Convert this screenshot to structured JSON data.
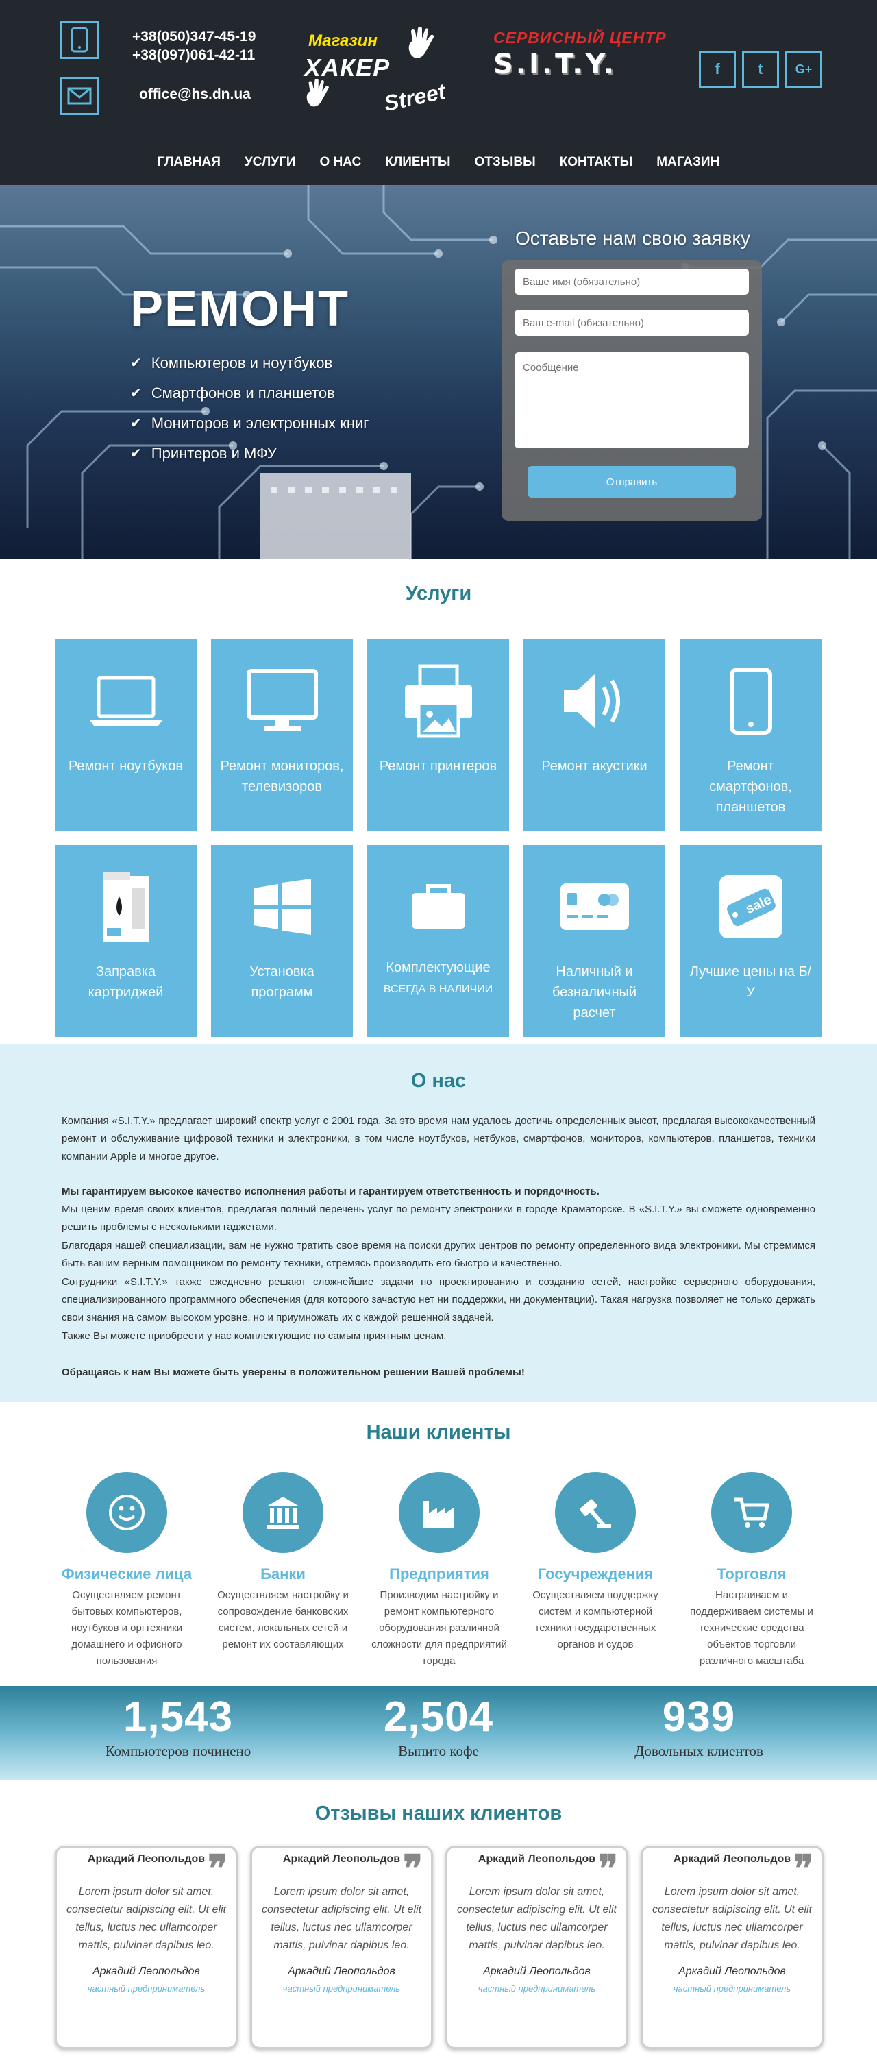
{
  "header": {
    "phones": [
      "+38(050)347-45-19",
      "+38(097)061-42-11"
    ],
    "email": "office@hs.dn.ua",
    "shop_logo": {
      "line1": "Магазин",
      "line2": "ХАКЕР",
      "line3": "Street"
    },
    "service_logo": {
      "line1": "СЕРВИСНЫЙ ЦЕНТР",
      "line2": "S.I.T.Y."
    },
    "social": [
      {
        "icon": "facebook-icon",
        "glyph": "f"
      },
      {
        "icon": "twitter-icon",
        "glyph": "t"
      },
      {
        "icon": "google-plus-icon",
        "glyph": "G+"
      }
    ],
    "nav": [
      "ГЛАВНАЯ",
      "УСЛУГИ",
      "О НАС",
      "КЛИЕНТЫ",
      "ОТЗЫВЫ",
      "КОНТАКТЫ",
      "МАГАЗИН"
    ]
  },
  "hero": {
    "title": "РЕМОНТ",
    "items": [
      "Компьютеров и ноутбуков",
      "Смартфонов и планшетов",
      "Мониторов и электронных книг",
      "Принтеров и МФУ"
    ],
    "form": {
      "title": "Оставьте нам свою заявку",
      "name_placeholder": "Ваше имя (обязательно)",
      "email_placeholder": "Ваш e-mail (обязательно)",
      "message_placeholder": "Сообщение",
      "submit": "Отправить"
    }
  },
  "services": {
    "title": "Услуги",
    "tiles": [
      {
        "label": "Ремонт ноутбуков",
        "icon": "laptop-icon"
      },
      {
        "label": "Ремонт мониторов, телевизоров",
        "icon": "monitor-icon"
      },
      {
        "label": "Ремонт принтеров",
        "icon": "printer-icon"
      },
      {
        "label": "Ремонт акустики",
        "icon": "speaker-icon"
      },
      {
        "label": "Ремонт смартфонов, планшетов",
        "icon": "smartphone-icon"
      },
      {
        "label": "Заправка картриджей",
        "icon": "cartridge-icon"
      },
      {
        "label": "Установка программ",
        "icon": "windows-icon"
      },
      {
        "label": "Комплектующие",
        "sub": "всегда в наличии",
        "icon": "toolbox-icon"
      },
      {
        "label": "Наличный и безналичный расчет",
        "icon": "credit-card-icon"
      },
      {
        "label": "Лучшие цены на Б/У",
        "icon": "sale-tag-icon"
      }
    ]
  },
  "about": {
    "title": "О нас",
    "p1": "Компания «S.I.T.Y.» предлагает широкий спектр услуг с 2001 года. За это время нам удалось достичь определенных высот, предлагая высококачественный ремонт и обслуживание цифровой техники и электроники, в том числе ноутбуков, нетбуков, смартфонов, мониторов, компьютеров, планшетов, техники компании Apple и многое другое.",
    "p2_bold": "Мы гарантируем высокое качество исполнения работы и гарантируем ответственность и порядочность.",
    "p2": "Мы ценим время своих клиентов, предлагая полный перечень услуг по ремонту электроники в городе Краматорске. В «S.I.T.Y.» вы сможете одновременно решить проблемы с несколькими гаджетами.",
    "p3": "Благодаря нашей специализации, вам не нужно тратить свое время на поиски других центров по ремонту определенного вида электроники. Мы стремимся быть вашим верным помощником по ремонту техники, стремясь производить его быстро и качественно.",
    "p4": "Сотрудники «S.I.T.Y.» также ежедневно решают сложнейшие задачи по проектированию и созданию сетей, настройке серверного оборудования, специализированного программного обеспечения (для которого зачастую нет ни поддержки, ни документации). Такая нагрузка позволяет не только держать свои знания на самом высоком уровне, но и приумножать их с каждой решенной задачей.",
    "p5": "Также Вы можете приобрести у нас комплектующие по самым приятным ценам.",
    "p6_bold": "Обращаясь к нам Вы можете быть уверены в положительном решении Вашей проблемы!"
  },
  "clients": {
    "title": "Наши клиенты",
    "items": [
      {
        "title": "Физические лица",
        "desc": "Осуществляем ремонт бытовых компьютеров, ноутбуков и оргтехники домашнего и офисного пользования",
        "icon": "smiley-icon"
      },
      {
        "title": "Банки",
        "desc": "Осуществляем настройку и сопровождение банковских систем, локальных сетей и ремонт их составляющих",
        "icon": "bank-icon"
      },
      {
        "title": "Предприятия",
        "desc": "Производим настройку и ремонт компьютерного оборудования различной сложности для предприятий города",
        "icon": "factory-icon"
      },
      {
        "title": "Госучреждения",
        "desc": "Осуществляем поддержку систем и компьютерной техники государственных органов и судов",
        "icon": "gavel-icon"
      },
      {
        "title": "Торговля",
        "desc": "Настраиваем и поддерживаем системы и технические средства объектов торговли различного масштаба",
        "icon": "cart-icon"
      }
    ]
  },
  "stats": [
    {
      "value": "1,543",
      "label": "Компьютеров починено"
    },
    {
      "value": "2,504",
      "label": "Выпито кофе"
    },
    {
      "value": "939",
      "label": "Довольных клиентов"
    }
  ],
  "reviews": {
    "title": "Отзывы наших клиентов",
    "items": [
      {
        "name": "Аркадий Леопольдов",
        "text": "Lorem ipsum dolor sit amet, consectetur adipiscing elit. Ut elit tellus, luctus nec ullamcorper mattis, pulvinar dapibus leo.",
        "author": "Аркадий Леопольдов",
        "role": "частный предприниматель"
      },
      {
        "name": "Аркадий Леопольдов",
        "text": "Lorem ipsum dolor sit amet, consectetur adipiscing elit. Ut elit tellus, luctus nec ullamcorper mattis, pulvinar dapibus leo.",
        "author": "Аркадий Леопольдов",
        "role": "частный предприниматель"
      },
      {
        "name": "Аркадий Леопольдов",
        "text": "Lorem ipsum dolor sit amet, consectetur adipiscing elit. Ut elit tellus, luctus nec ullamcorper mattis, pulvinar dapibus leo.",
        "author": "Аркадий Леопольдов",
        "role": "частный предприниматель"
      },
      {
        "name": "Аркадий Леопольдов",
        "text": "Lorem ipsum dolor sit amet, consectetur adipiscing elit. Ut elit tellus, luctus nec ullamcorper mattis, pulvinar dapibus leo.",
        "author": "Аркадий Леопольдов",
        "role": "частный предприниматель"
      }
    ]
  },
  "colors": {
    "accent": "#63b9e0",
    "header_bg": "#22282e",
    "title": "#2a7f8f",
    "about_bg": "#dcf0f8"
  }
}
